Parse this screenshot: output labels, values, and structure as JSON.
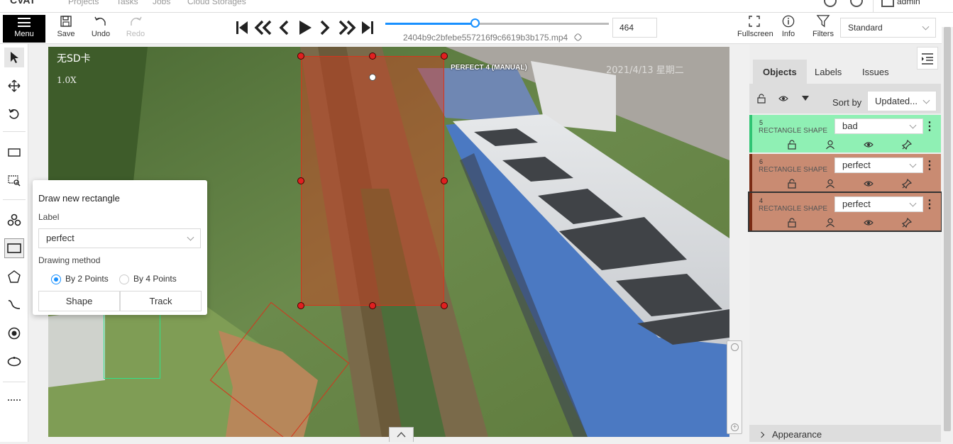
{
  "app": {
    "logo": "CVAT"
  },
  "topnav": {
    "items": [
      "Projects",
      "Tasks",
      "Jobs",
      "Cloud Storages"
    ],
    "user": "admin"
  },
  "toolbar": {
    "menu_label": "Menu",
    "save_label": "Save",
    "undo_label": "Undo",
    "redo_label": "Redo",
    "filename": "2404b9c2bfebe557216f9c6619b3b175.mp4",
    "frame_number": "464",
    "frame_progress": 0.4,
    "fullscreen_label": "Fullscreen",
    "info_label": "Info",
    "filters_label": "Filters",
    "workspace_select": "Standard"
  },
  "canvas": {
    "overlay_text_1": "无SD卡",
    "overlay_text_2": "1.0X",
    "overlay_text_3": "2021/4/13 星期二",
    "selected_shape_label": "PERFECT 4 (MANUAL)"
  },
  "popover": {
    "title": "Draw new rectangle",
    "label_heading": "Label",
    "label_value": "perfect",
    "method_heading": "Drawing method",
    "method_two_points": "By 2 Points",
    "method_four_points": "By 4 Points",
    "shape_button": "Shape",
    "track_button": "Track"
  },
  "sidebar": {
    "tabs": [
      "Objects",
      "Labels",
      "Issues"
    ],
    "sort_by_label": "Sort by",
    "sort_value": "Updated...",
    "objects": [
      {
        "id": "5",
        "type": "RECTANGLE SHAPE",
        "label": "bad",
        "color": "#8ff0b4",
        "border": "#2fc473"
      },
      {
        "id": "6",
        "type": "RECTANGLE SHAPE",
        "label": "perfect",
        "color": "#c98b72",
        "border": "#7a2b14"
      },
      {
        "id": "4",
        "type": "RECTANGLE SHAPE",
        "label": "perfect",
        "color": "#c98b72",
        "border": "#7a2b14"
      }
    ],
    "appearance_label": "Appearance"
  }
}
